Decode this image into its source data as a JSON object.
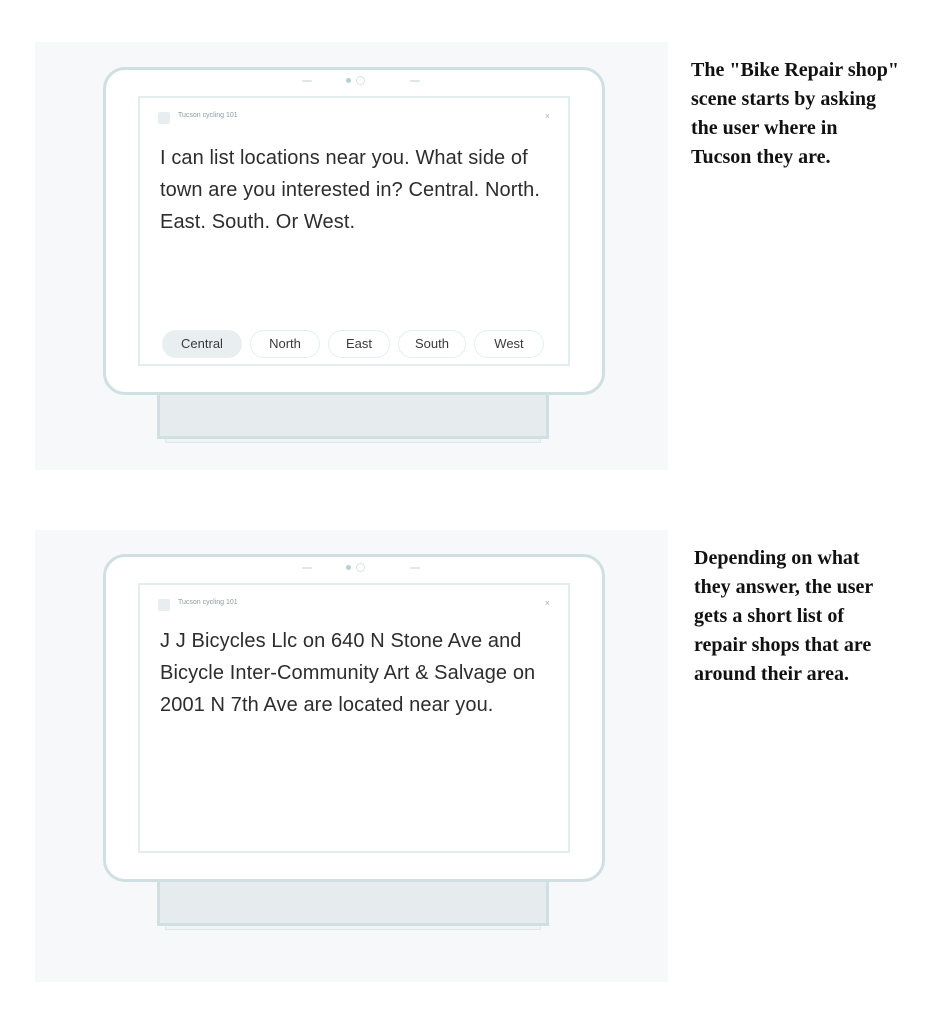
{
  "screen1": {
    "app_name": "Tucson cycling 101",
    "close_icon": "×",
    "speech": "I can list locations near you. What side of town are you interested in? Central. North. East. South. Or West.",
    "chips": [
      "Central",
      "North",
      "East",
      "South",
      "West"
    ],
    "active_chip": "Central"
  },
  "screen2": {
    "app_name": "Tucson cycling 101",
    "close_icon": "×",
    "speech": "J J Bicycles Llc on 640 N Stone Ave and Bicycle Inter-Community Art & Salvage on 2001 N 7th Ave are located near you."
  },
  "captions": {
    "first": "The \"Bike Repair shop\"\nscene starts by asking\nthe user where in\nTucson they are.",
    "second": "Depending on what\nthey answer, the user\ngets a short list of\nrepair shops that are\naround their area."
  },
  "colors": {
    "device_border": "#cfdfe2",
    "panel_bg": "#f6f8fa",
    "active_chip_bg": "#e9eff1"
  }
}
